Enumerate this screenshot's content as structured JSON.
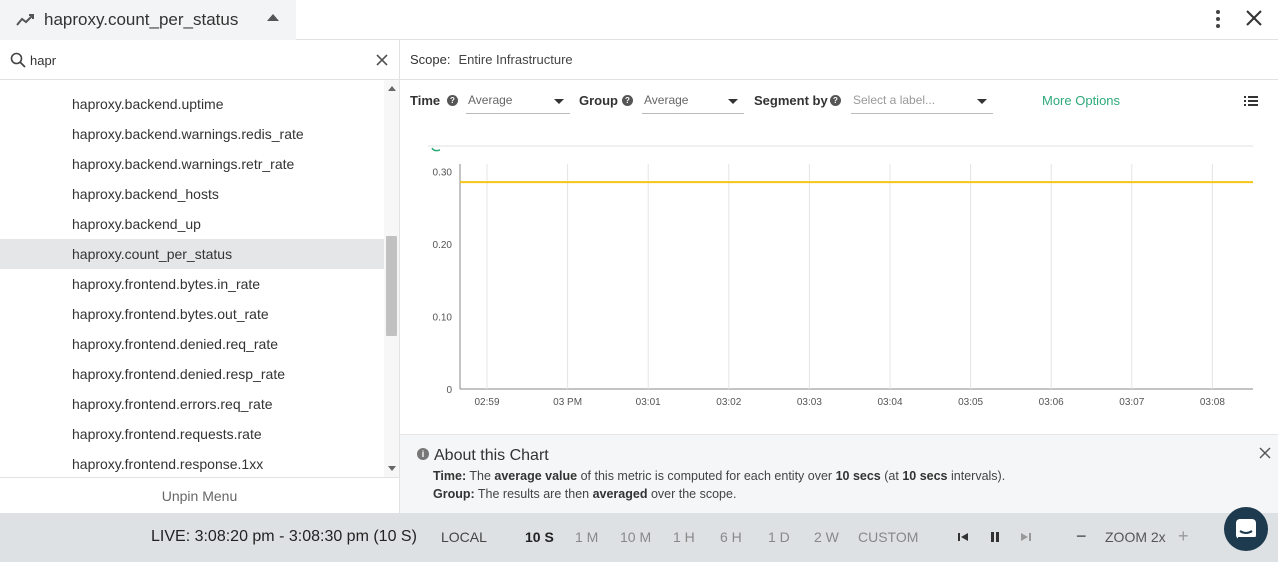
{
  "header": {
    "metric_title": "haproxy.count_per_status",
    "trend_icon": "line-chart-icon",
    "collapse_icon": "caret-up-icon",
    "menu_icon": "kebab-menu-icon",
    "close_icon": "close-icon"
  },
  "sidebar": {
    "search_value": "hapr",
    "items": [
      "haproxy.backend.uptime",
      "haproxy.backend.warnings.redis_rate",
      "haproxy.backend.warnings.retr_rate",
      "haproxy.backend_hosts",
      "haproxy.backend_up",
      "haproxy.count_per_status",
      "haproxy.frontend.bytes.in_rate",
      "haproxy.frontend.bytes.out_rate",
      "haproxy.frontend.denied.req_rate",
      "haproxy.frontend.denied.resp_rate",
      "haproxy.frontend.errors.req_rate",
      "haproxy.frontend.requests.rate",
      "haproxy.frontend.response.1xx"
    ],
    "selected_index": 5,
    "scroll_position": 0.55,
    "unpin_label": "Unpin Menu"
  },
  "scope": {
    "label": "Scope:",
    "value": "Entire Infrastructure"
  },
  "controls": {
    "time_label": "Time",
    "time_value": "Average",
    "group_label": "Group",
    "group_value": "Average",
    "segment_label": "Segment by",
    "segment_placeholder": "Select a label...",
    "more_options": "More Options"
  },
  "chart_data": {
    "type": "line",
    "x": [
      "02:59",
      "03 PM",
      "03:01",
      "03:02",
      "03:03",
      "03:04",
      "03:05",
      "03:06",
      "03:07",
      "03:08"
    ],
    "series": [
      {
        "color": "#f5c518",
        "values": [
          0.285,
          0.285,
          0.285,
          0.285,
          0.285,
          0.285,
          0.285,
          0.285,
          0.285,
          0.285
        ]
      }
    ],
    "yticks": [
      "0",
      "0.10",
      "0.20",
      "0.30"
    ],
    "ylim": [
      0,
      0.31
    ],
    "grid": "vertical"
  },
  "about": {
    "title": "About this Chart",
    "time_prefix": "Time:",
    "time_text_1": "The",
    "time_bold_1": "average value",
    "time_text_2": "of this metric is computed for each entity over",
    "time_bold_2": "10 secs",
    "time_text_3": "(at",
    "time_bold_3": "10 secs",
    "time_text_4": "intervals).",
    "group_prefix": "Group:",
    "group_text_1": "The results are then",
    "group_bold_1": "averaged",
    "group_text_2": "over the scope."
  },
  "bottom": {
    "live": "LIVE: 3:08:20 pm - 3:08:30 pm (10 S)",
    "timezone": "LOCAL",
    "ranges": [
      "10 S",
      "1 M",
      "10 M",
      "1 H",
      "6 H",
      "1 D",
      "2 W",
      "CUSTOM"
    ],
    "active_range": "10 S",
    "zoom": "ZOOM 2x",
    "zoom_out": "−",
    "zoom_in": "+"
  }
}
